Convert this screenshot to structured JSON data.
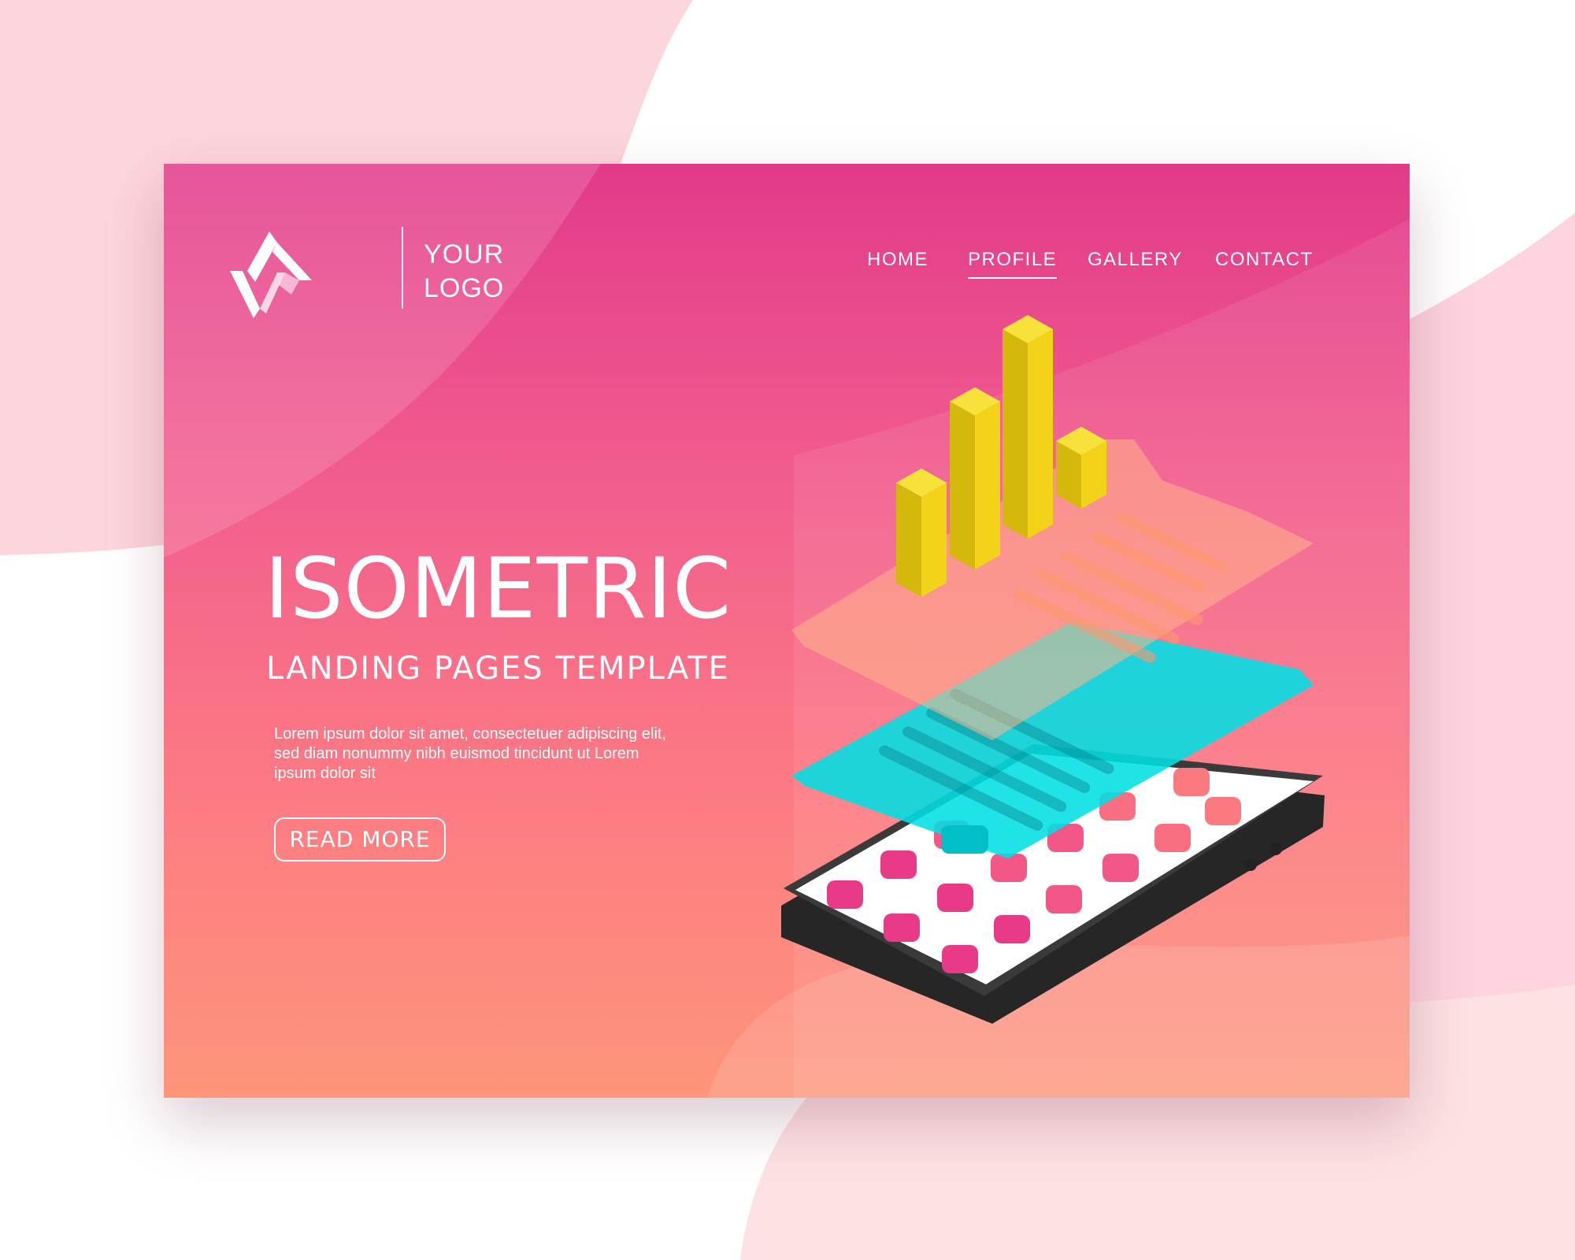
{
  "logo": {
    "text": "YOUR LOGO"
  },
  "nav": {
    "items": [
      {
        "label": "HOME",
        "active": false
      },
      {
        "label": "PROFILE",
        "active": true
      },
      {
        "label": "GALLERY",
        "active": false
      },
      {
        "label": "CONTACT",
        "active": false
      }
    ]
  },
  "hero": {
    "title": "ISOMETRIC",
    "subtitle": "LANDING PAGES TEMPLATE",
    "body": "Lorem ipsum dolor sit amet, consectetuer adipiscing elit, sed diam nonummy nibh euismod tincidunt ut Lorem ipsum dolor sit",
    "button_label": "READ MORE"
  },
  "illustration": {
    "bar_levels": [
      0.41,
      0.63,
      0.8,
      0.22
    ],
    "icons": [
      "isometric-bar-chart-icon",
      "document-layer-icon",
      "smartphone-icon"
    ]
  },
  "colors": {
    "accent_pink": "#e23a8a",
    "coral": "#fd957a",
    "bar_yellow": "#f3d21a",
    "layer_cyan": "#00dfe4",
    "app_tile": "#e83a86"
  }
}
